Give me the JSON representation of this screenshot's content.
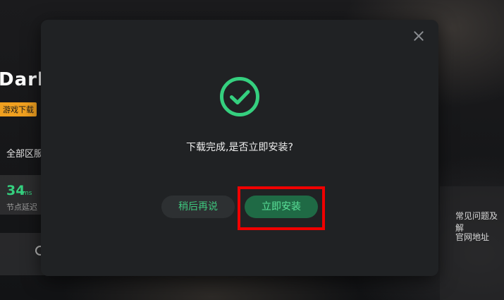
{
  "background": {
    "game_title": "Dark",
    "tag": "游戏下载",
    "region": "全部区服",
    "ping": {
      "value": "34",
      "unit": "ms",
      "label": "节点延迟"
    },
    "links": [
      "常见问题及解",
      "官网地址"
    ]
  },
  "dialog": {
    "message": "下载完成,是否立即安装?",
    "later_label": "稍后再说",
    "install_label": "立即安装",
    "icon": "check-circle-icon",
    "close_icon": "close-icon"
  },
  "colors": {
    "success": "#35d07f",
    "modal_bg": "#202224",
    "primary_button": "#1f6a45",
    "highlight": "#f00000"
  }
}
